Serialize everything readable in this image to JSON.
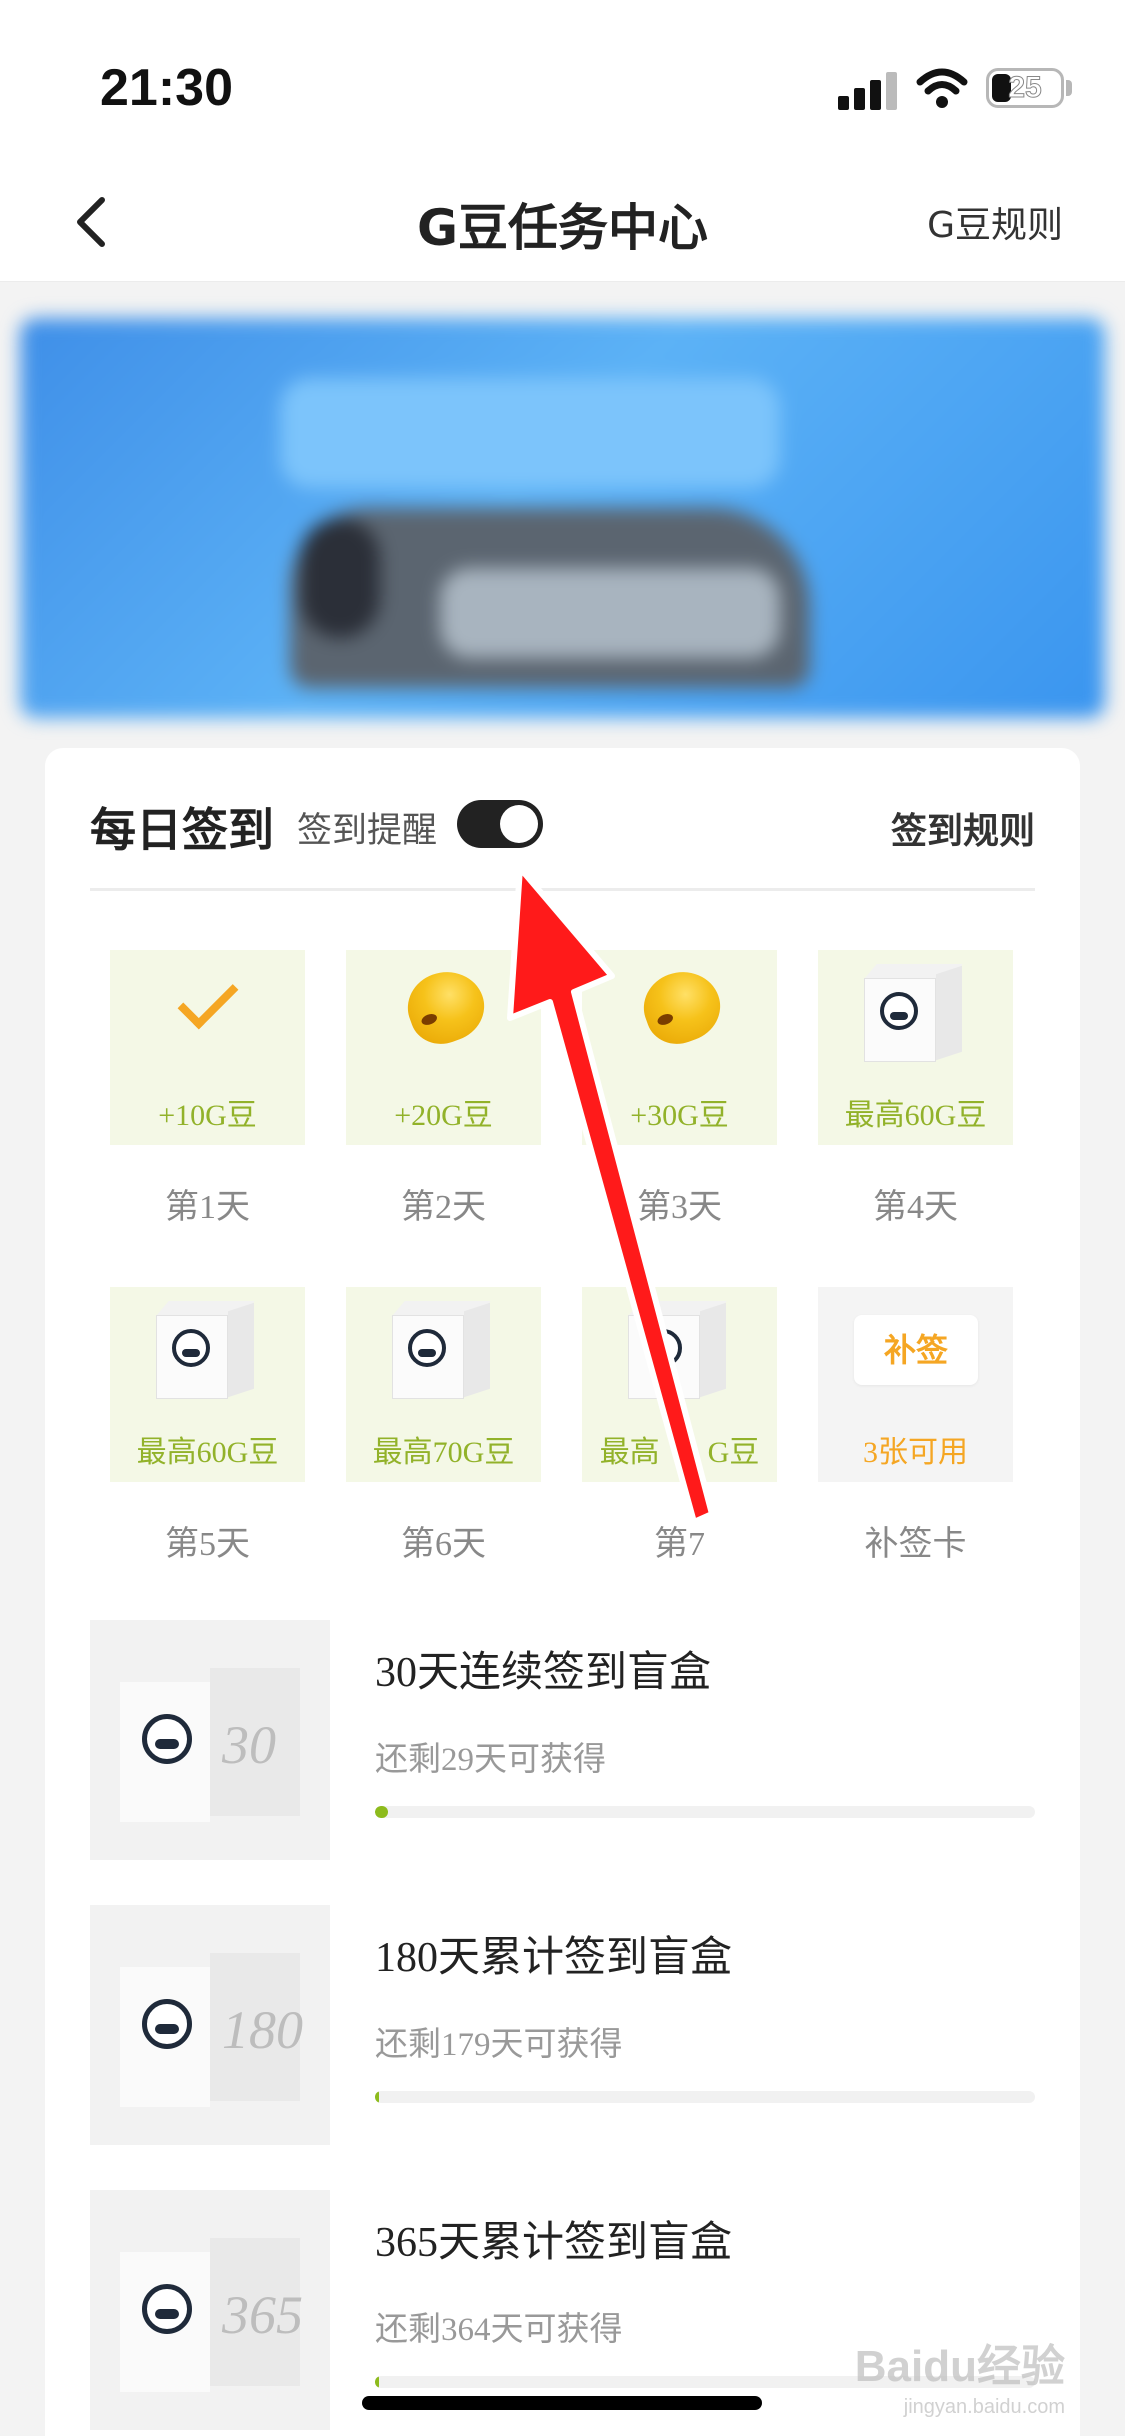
{
  "status_bar": {
    "time": "21:30",
    "battery_level": "25",
    "icons": [
      "cellular-signal-icon",
      "wifi-icon",
      "battery-icon"
    ]
  },
  "nav": {
    "title": "G豆任务中心",
    "right_link": "G豆规则",
    "back_icon": "chevron-left-icon"
  },
  "banner": {},
  "checkin": {
    "title": "每日签到",
    "reminder_label": "签到提醒",
    "reminder_on": true,
    "rules_link": "签到规则",
    "days": [
      {
        "reward": "+10G豆",
        "label": "第1天",
        "icon": "checkmark-icon",
        "claimed": true
      },
      {
        "reward": "+20G豆",
        "label": "第2天",
        "icon": "bean-icon"
      },
      {
        "reward": "+30G豆",
        "label": "第3天",
        "icon": "bean-icon"
      },
      {
        "reward": "最高60G豆",
        "label": "第4天",
        "icon": "gift-box-icon"
      },
      {
        "reward": "最高60G豆",
        "label": "第5天",
        "icon": "gift-box-icon"
      },
      {
        "reward": "最高70G豆",
        "label": "第6天",
        "icon": "gift-box-icon"
      },
      {
        "reward": "最高",
        "reward_suffix": "G豆",
        "label": "第7",
        "icon": "gift-box-icon"
      },
      {
        "badge": "补签",
        "reward": "3张可用",
        "label": "补签卡",
        "icon": "makeup-ticket-icon"
      }
    ]
  },
  "blind_boxes": [
    {
      "name": "30天连续签到盲盒",
      "remaining": "还剩29天可获得",
      "cube_number": "30",
      "progress": 0.02
    },
    {
      "name": "180天累计签到盲盒",
      "remaining": "还剩179天可获得",
      "cube_number": "180",
      "progress": 0.006
    },
    {
      "name": "365天累计签到盲盒",
      "remaining": "还剩364天可获得",
      "cube_number": "365",
      "progress": 0.003
    }
  ],
  "watermark": {
    "text": "Baidu经验",
    "sub": "jingyan.baidu.com"
  },
  "colors": {
    "accent_green": "#8dbb1c",
    "reward_green": "#92b22a",
    "orange": "#f5a623",
    "annotation_red": "#ff1a1a"
  }
}
